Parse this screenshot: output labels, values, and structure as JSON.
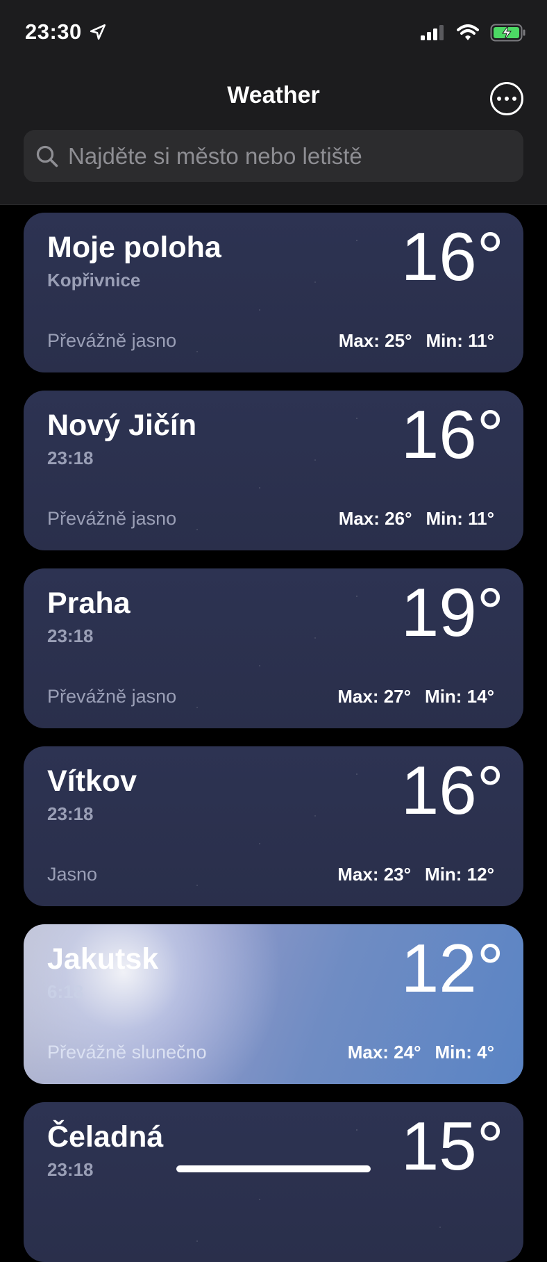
{
  "status_bar": {
    "time": "23:30"
  },
  "header": {
    "title": "Weather"
  },
  "search": {
    "placeholder": "Najděte si město nebo letiště"
  },
  "cities": [
    {
      "name": "Moje poloha",
      "sub": "Kopřivnice",
      "temp": "16°",
      "condition": "Převážně jasno",
      "max": "Max: 25°",
      "min": "Min: 11°"
    },
    {
      "name": "Nový Jičín",
      "sub": "23:18",
      "temp": "16°",
      "condition": "Převážně jasno",
      "max": "Max: 26°",
      "min": "Min: 11°"
    },
    {
      "name": "Praha",
      "sub": "23:18",
      "temp": "19°",
      "condition": "Převážně jasno",
      "max": "Max: 27°",
      "min": "Min: 14°"
    },
    {
      "name": "Vítkov",
      "sub": "23:18",
      "temp": "16°",
      "condition": "Jasno",
      "max": "Max: 23°",
      "min": "Min: 12°"
    },
    {
      "name": "Jakutsk",
      "sub": "6:18",
      "temp": "12°",
      "condition": "Převážně slunečno",
      "max": "Max: 24°",
      "min": "Min: 4°"
    },
    {
      "name": "Čeladná",
      "sub": "23:18",
      "temp": "15°"
    }
  ]
}
